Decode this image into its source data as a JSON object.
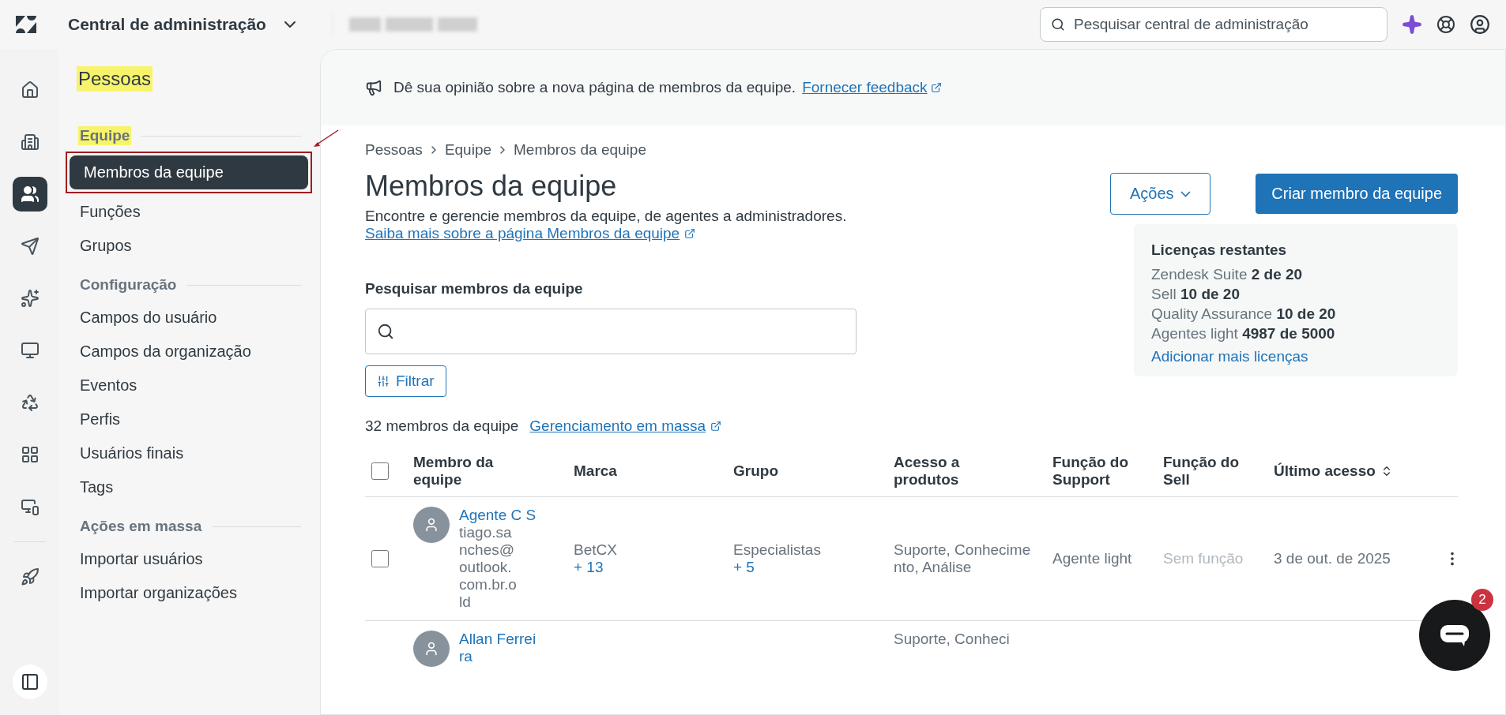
{
  "topbar": {
    "title": "Central de administração",
    "search_placeholder": "Pesquisar central de administração"
  },
  "rail": [
    {
      "kind": "home",
      "selected": false
    },
    {
      "kind": "building",
      "selected": false
    },
    {
      "kind": "people",
      "selected": true
    },
    {
      "kind": "send",
      "selected": false
    },
    {
      "kind": "sparkles",
      "selected": false
    },
    {
      "kind": "monitor",
      "selected": false
    },
    {
      "kind": "recycle",
      "selected": false
    },
    {
      "kind": "apps",
      "selected": false
    },
    {
      "kind": "devices",
      "selected": false
    },
    {
      "kind": "rocket",
      "selected": false
    }
  ],
  "sidebar": {
    "heading": "Pessoas",
    "sections": [
      {
        "title": "Equipe",
        "highlighted": true,
        "items": [
          {
            "label": "Membros da equipe",
            "selected": true
          },
          {
            "label": "Funções",
            "selected": false
          },
          {
            "label": "Grupos",
            "selected": false
          }
        ]
      },
      {
        "title": "Configuração",
        "highlighted": false,
        "items": [
          {
            "label": "Campos do usuário",
            "selected": false
          },
          {
            "label": "Campos da organização",
            "selected": false
          },
          {
            "label": "Eventos",
            "selected": false
          },
          {
            "label": "Perfis",
            "selected": false
          },
          {
            "label": "Usuários finais",
            "selected": false
          },
          {
            "label": "Tags",
            "selected": false
          }
        ]
      },
      {
        "title": "Ações em massa",
        "highlighted": false,
        "items": [
          {
            "label": "Importar usuários",
            "selected": false
          },
          {
            "label": "Importar organizações",
            "selected": false
          }
        ]
      }
    ]
  },
  "banner": {
    "text": "Dê sua opinião sobre a nova página de membros da equipe.",
    "link": "Fornecer feedback"
  },
  "breadcrumb": [
    "Pessoas",
    "Equipe",
    "Membros da equipe"
  ],
  "page": {
    "title": "Membros da equipe",
    "description": "Encontre e gerencie membros da equipe, de agentes a administradores.",
    "learn_link": "Saiba mais sobre a página Membros da equipe"
  },
  "actions_button": "Ações",
  "create_button": "Criar membro da equipe",
  "licenses": {
    "title": "Licenças restantes",
    "rows": [
      {
        "name": "Zendesk Suite",
        "value": "2 de 20"
      },
      {
        "name": "Sell",
        "value": "10 de 20"
      },
      {
        "name": "Quality Assurance",
        "value": "10 de 20"
      },
      {
        "name": "Agentes light",
        "value": "4987 de 5000"
      }
    ],
    "link": "Adicionar mais licenças"
  },
  "search": {
    "label": "Pesquisar membros da equipe"
  },
  "filter_button": "Filtrar",
  "count": "32 membros da equipe",
  "bulk_link": "Gerenciamento em massa",
  "table": {
    "header_checked": false,
    "columns": [
      {
        "label": "Membro da equipe",
        "sortable": false
      },
      {
        "label": "Marca",
        "sortable": false
      },
      {
        "label": "Grupo",
        "sortable": false
      },
      {
        "label": "Acesso a produtos",
        "sortable": false
      },
      {
        "label": "Função do Support",
        "sortable": false
      },
      {
        "label": "Função do Sell",
        "sortable": false
      },
      {
        "label": "Último acesso",
        "sortable": true
      }
    ],
    "rows": [
      {
        "checked": false,
        "name": "Agente C S",
        "email": "tiago.sanches@outlook.com.br.old",
        "brand": "BetCX",
        "brand_more": "+ 13",
        "group": "Especialistas",
        "group_more": "+ 5",
        "access": "Suporte, Conhecimento, Análise",
        "support_role": "Agente light",
        "sell_role": "Sem função",
        "sell_role_muted": true,
        "last_access": "3 de out. de 2025"
      },
      {
        "name": "Allan Ferreira",
        "access": "Suporte, Conheci"
      }
    ]
  },
  "chat_badge": "2"
}
